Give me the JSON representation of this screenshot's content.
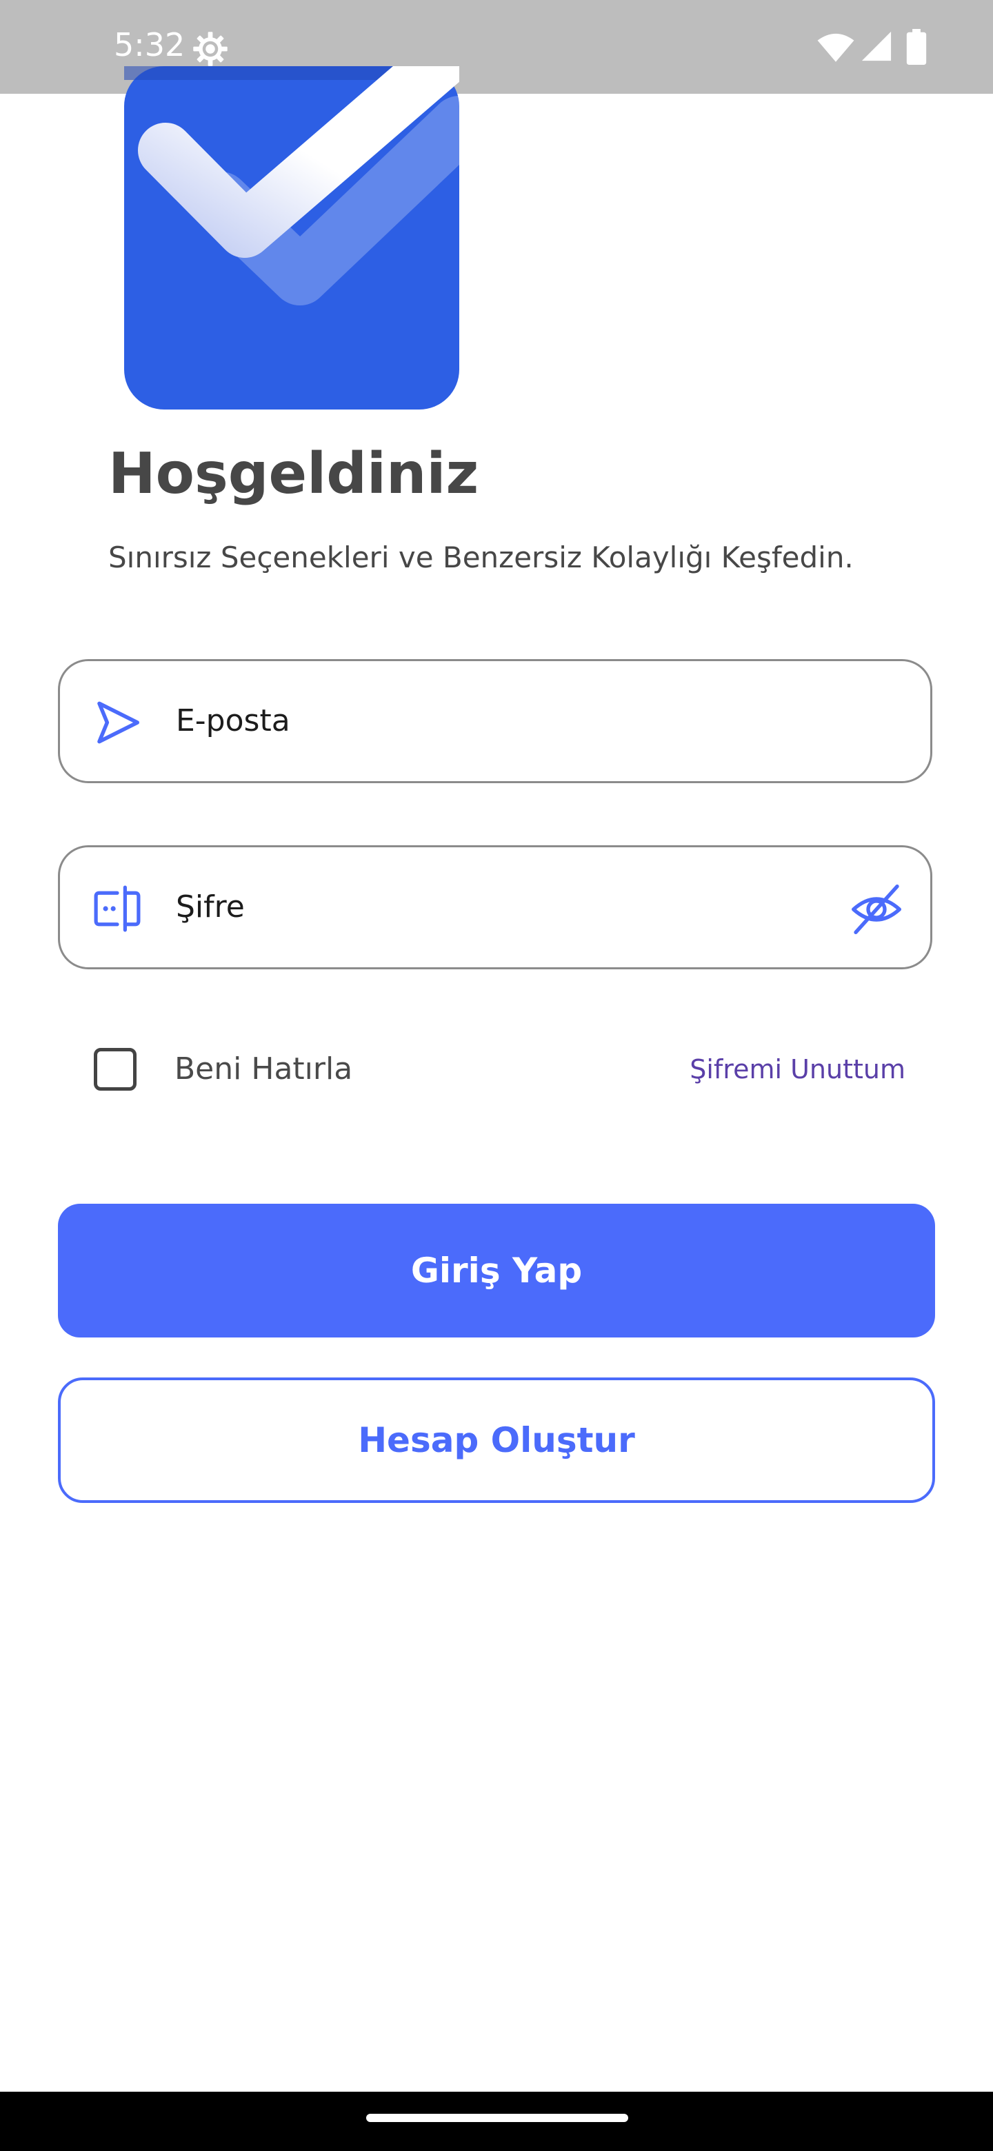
{
  "status_bar": {
    "time": "5:32",
    "icons": [
      "gear-icon",
      "wifi-icon",
      "signal-icon",
      "battery-icon"
    ]
  },
  "welcome": {
    "title": "Hoşgeldiniz",
    "subtitle": "Sınırsız Seçenekleri ve Benzersiz Kolaylığı Keşfedin."
  },
  "form": {
    "email_placeholder": "E-posta",
    "email_icon": "send-arrow-icon",
    "password_placeholder": "Şifre",
    "password_icon": "password-input-icon",
    "visibility_icon": "eye-off-icon",
    "remember_me_label": "Beni Hatırla",
    "remember_me_checked": false,
    "forgot_password_label": "Şifremi Unuttum"
  },
  "actions": {
    "login_label": "Giriş Yap",
    "register_label": "Hesap Oluştur"
  },
  "colors": {
    "primary": "#4b6bfb",
    "logo_blue": "#2d5fe4",
    "link_purple": "#5a3fa8",
    "status_bar": "#bdbdbd",
    "text_dark": "#474747"
  }
}
